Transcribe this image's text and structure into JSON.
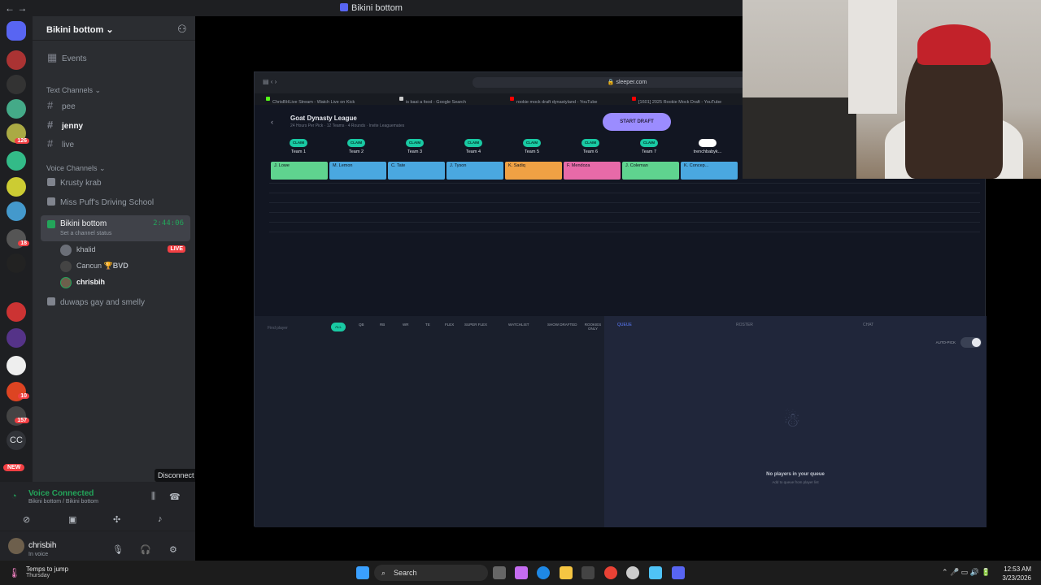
{
  "window": {
    "title": "Bikini bottom"
  },
  "rail": {
    "badges": [
      "126",
      "18",
      "10",
      "157"
    ],
    "cc_label": "CC",
    "new_label": "NEW"
  },
  "server": {
    "name": "Bikini bottom"
  },
  "channels": {
    "events": "Events",
    "text_header": "Text Channels",
    "text": [
      "pee",
      "jenny",
      "live"
    ],
    "voice_header": "Voice Channels",
    "voice": [
      "Krusty krab",
      "Miss Puff's Driving School"
    ],
    "active": {
      "name": "Bikini bottom",
      "timer": "2:44:06",
      "status": "Set a channel status"
    },
    "members": [
      {
        "name": "khalid",
        "live": "LIVE"
      },
      {
        "name": "Cancun",
        "tag": "BVD"
      },
      {
        "name": "chrisbih"
      }
    ],
    "other_voice": "duwaps gay and smelly"
  },
  "tooltip": "Disconnect",
  "voice_panel": {
    "title": "Voice Connected",
    "subtitle": "Bikini bottom / Bikini bottom"
  },
  "user": {
    "name": "chrisbih",
    "status": "In voice"
  },
  "browser": {
    "url": "sleeper.com",
    "tabs": [
      "ChrisBHLive Stream - Watch Live on Kick",
      "is basi a food - Google Search",
      "rookie mock draft dynastyland - YouTube",
      "[1601] 2025 Rookie Mock Draft - YouTube"
    ],
    "league": "Goat Dynasty League",
    "league_sub": "24 Hours Per Pick · 12 Teams · 4 Rounds · Invite Leaguemates",
    "start_draft": "START DRAFT",
    "claim": "CLAIM",
    "teams": [
      "Team 1",
      "Team 2",
      "Team 3",
      "Team 4",
      "Team 5",
      "Team 6",
      "Team 7",
      "trenchbabyk..."
    ],
    "picks": [
      {
        "name": "J. Lowe",
        "color": "#5fd38f"
      },
      {
        "name": "M. Lemon",
        "color": "#4aa8e0"
      },
      {
        "name": "C. Tate",
        "color": "#4aa8e0"
      },
      {
        "name": "J. Tyson",
        "color": "#4aa8e0"
      },
      {
        "name": "K. Sadiq",
        "color": "#f0a144"
      },
      {
        "name": "F. Mendoza",
        "color": "#e76aa8"
      },
      {
        "name": "J. Coleman",
        "color": "#5fd38f"
      },
      {
        "name": "K. Concep...",
        "color": "#4aa8e0"
      }
    ],
    "filters": [
      "ALL",
      "QB",
      "RB",
      "WR",
      "TE",
      "FLEX",
      "SUPER FLEX",
      "WATCHLIST",
      "SHOW DRAFTED",
      "ROOKIES ONLY"
    ],
    "find_placeholder": "Find player",
    "queue_tabs": [
      "QUEUE",
      "ROSTER",
      "CHAT"
    ],
    "auto_pick": "AUTO-PICK",
    "empty_title": "No players in your queue",
    "empty_sub": "Add to queue from player list"
  },
  "taskbar": {
    "weather": "Temps to jump",
    "weather_sub": "Thursday",
    "search": "Search",
    "time": "12:53 AM",
    "date": "3/23/2026"
  }
}
